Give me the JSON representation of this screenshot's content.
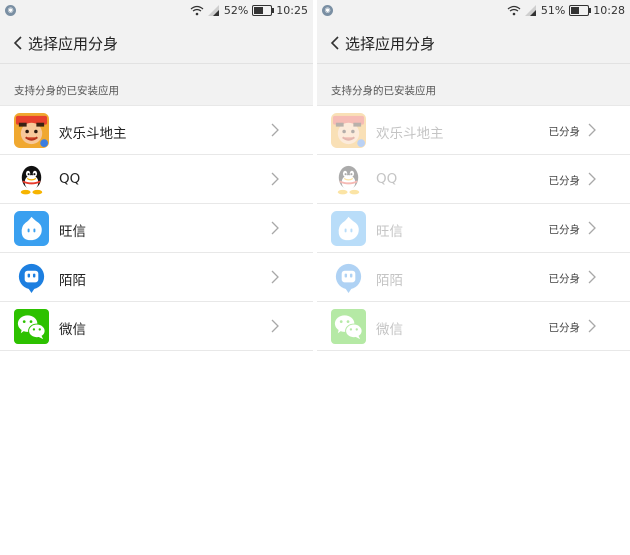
{
  "left": {
    "status": {
      "battery": "52%",
      "time": "10:25",
      "battery_level": 0.52
    },
    "title": "选择应用分身",
    "section_header": "支持分身的已安装应用",
    "apps": [
      {
        "name": "欢乐斗地主",
        "icon": "doudizhu-icon"
      },
      {
        "name": "QQ",
        "icon": "qq-penguin-icon"
      },
      {
        "name": "旺信",
        "icon": "wangxin-icon"
      },
      {
        "name": "陌陌",
        "icon": "momo-icon"
      },
      {
        "name": "微信",
        "icon": "wechat-icon"
      }
    ]
  },
  "right": {
    "status": {
      "battery": "51%",
      "time": "10:28",
      "battery_level": 0.51
    },
    "title": "选择应用分身",
    "section_header": "支持分身的已安装应用",
    "cloned_label": "已分身",
    "apps": [
      {
        "name": "欢乐斗地主",
        "icon": "doudizhu-icon",
        "status": "已分身"
      },
      {
        "name": "QQ",
        "icon": "qq-penguin-icon",
        "status": "已分身"
      },
      {
        "name": "旺信",
        "icon": "wangxin-icon",
        "status": "已分身"
      },
      {
        "name": "陌陌",
        "icon": "momo-icon",
        "status": "已分身"
      },
      {
        "name": "微信",
        "icon": "wechat-icon",
        "status": "已分身"
      }
    ]
  },
  "colors": {
    "background": "#f2f2f2",
    "row_background": "#ffffff",
    "qq_blue": "#2a8de0",
    "wangxin_blue": "#3aa0f0",
    "momo_blue": "#1d7fe0",
    "wechat_green": "#2dc100"
  }
}
